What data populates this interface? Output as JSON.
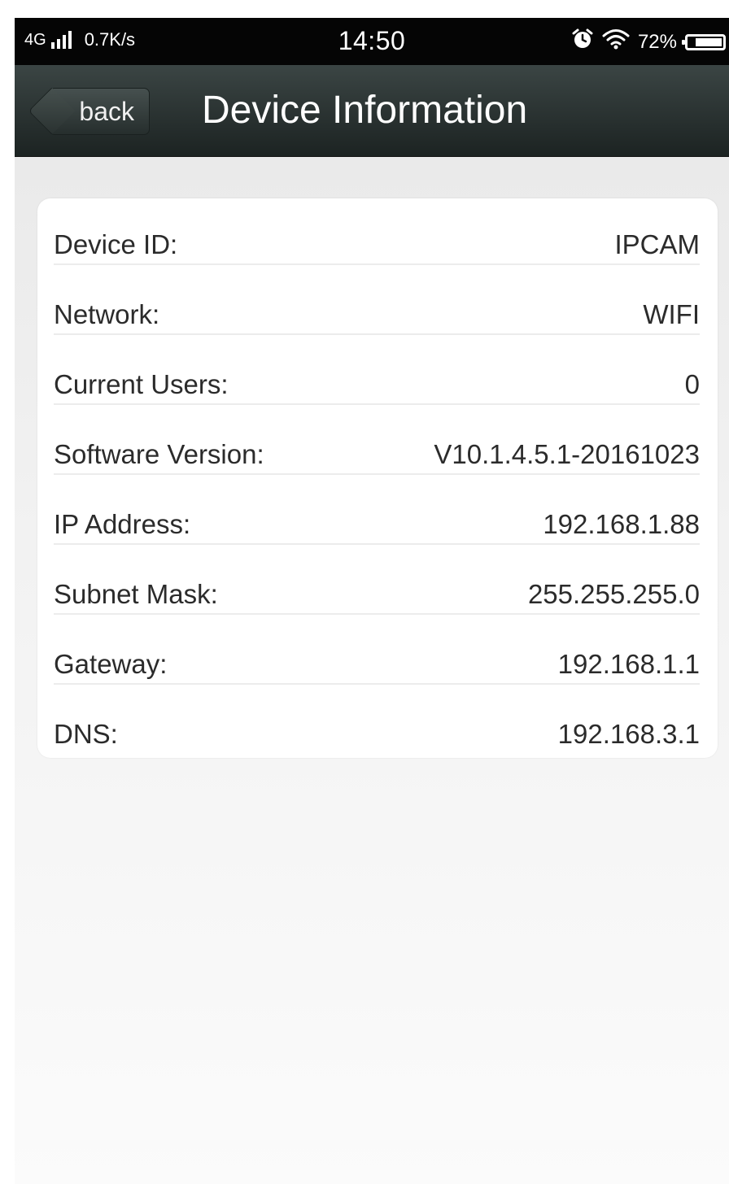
{
  "status_bar": {
    "network_type": "4G",
    "speed": "0.7K/s",
    "time": "14:50",
    "battery": "72%",
    "icons": [
      "signal-icon",
      "alarm-icon",
      "wifi-icon",
      "battery-icon"
    ]
  },
  "nav": {
    "back_label": "back",
    "title": "Device Information"
  },
  "info": [
    {
      "label": "Device ID:",
      "value": "IPCAM"
    },
    {
      "label": "Network:",
      "value": "WIFI"
    },
    {
      "label": "Current Users:",
      "value": "0"
    },
    {
      "label": "Software Version:",
      "value": "V10.1.4.5.1-20161023"
    },
    {
      "label": "IP Address:",
      "value": "192.168.1.88"
    },
    {
      "label": "Subnet Mask:",
      "value": "255.255.255.0"
    },
    {
      "label": "Gateway:",
      "value": "192.168.1.1"
    },
    {
      "label": "DNS:",
      "value": "192.168.3.1"
    }
  ],
  "colors": {
    "status_bar_bg": "#050505",
    "nav_bar_bg": "#2a3332",
    "card_bg": "#ffffff",
    "text": "#2b2b2b"
  }
}
